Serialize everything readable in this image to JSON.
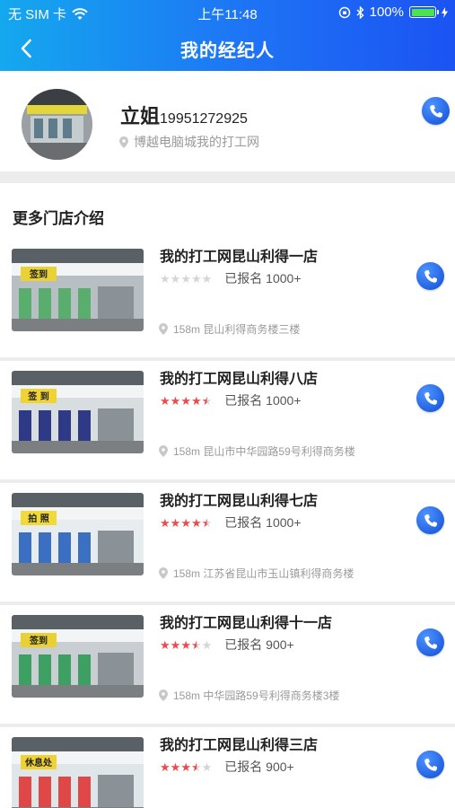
{
  "status_bar": {
    "carrier": "无 SIM 卡",
    "time": "上午11:48",
    "battery": "100%",
    "battery_level": 1.0
  },
  "nav": {
    "title": "我的经纪人",
    "back_icon": "chevron-left-icon"
  },
  "agent": {
    "name": "立姐",
    "phone": "19951272925",
    "location": "博越电脑城我的打工网"
  },
  "section_title": "更多门店介绍",
  "colors": {
    "brand_start": "#14a8ee",
    "brand_end": "#1b53f2",
    "star_on": "#f0484b",
    "star_off": "#d5d5d5",
    "call_button": "#2a6df0"
  },
  "stores": [
    {
      "name": "我的打工网昆山利得一店",
      "rating": 0,
      "signup": "已报名 1000+",
      "address": "158m 昆山利得商务楼三楼",
      "sign": "签到"
    },
    {
      "name": "我的打工网昆山利得八店",
      "rating": 4.5,
      "signup": "已报名 1000+",
      "address": "158m 昆山市中华园路59号利得商务楼",
      "sign": "签 到"
    },
    {
      "name": "我的打工网昆山利得七店",
      "rating": 4.5,
      "signup": "已报名 1000+",
      "address": "158m 江苏省昆山市玉山镇利得商务楼",
      "sign": "拍 照"
    },
    {
      "name": "我的打工网昆山利得十一店",
      "rating": 3.5,
      "signup": "已报名 900+",
      "address": "158m 中华园路59号利得商务楼3楼",
      "sign": "签到"
    },
    {
      "name": "我的打工网昆山利得三店",
      "rating": 3.5,
      "signup": "已报名 900+",
      "address": "",
      "sign": "休息处"
    }
  ]
}
